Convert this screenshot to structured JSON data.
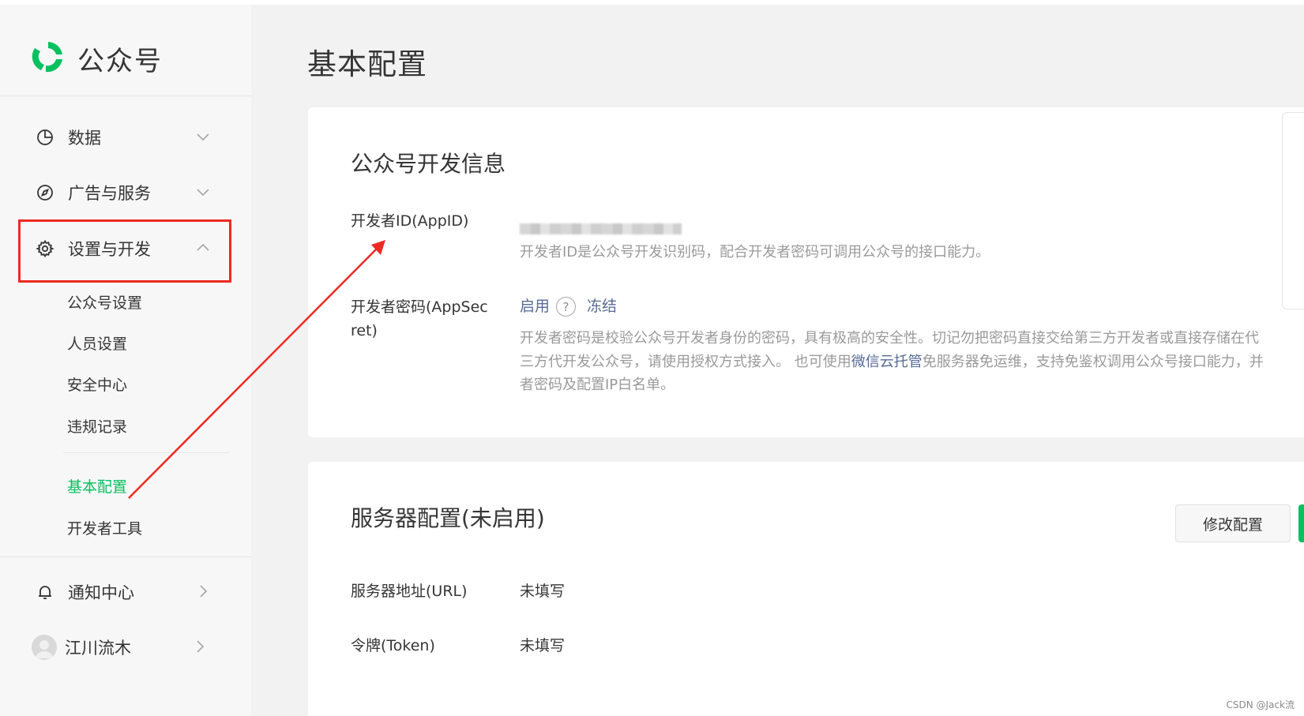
{
  "app": {
    "name": "公众号"
  },
  "sidebar": {
    "menus": [
      {
        "label": "数据",
        "icon": "chart-pie-icon",
        "chevron": "chevron-down-icon"
      },
      {
        "label": "广告与服务",
        "icon": "compass-icon",
        "chevron": "chevron-down-icon"
      },
      {
        "label": "设置与开发",
        "icon": "gear-icon",
        "chevron": "chevron-up-icon"
      }
    ],
    "submenu": [
      {
        "label": "公众号设置"
      },
      {
        "label": "人员设置"
      },
      {
        "label": "安全中心"
      },
      {
        "label": "违规记录"
      },
      {
        "label": "基本配置",
        "active": true
      },
      {
        "label": "开发者工具"
      }
    ],
    "notification": {
      "label": "通知中心",
      "icon": "bell-icon"
    },
    "account": {
      "label": "江川流木"
    }
  },
  "page": {
    "title": "基本配置"
  },
  "dev_info": {
    "title": "公众号开发信息",
    "appid": {
      "label": "开发者ID(AppID)",
      "hint": "开发者ID是公众号开发识别码，配合开发者密码可调用公众号的接口能力。"
    },
    "appsecret": {
      "label_line1": "开发者密码(AppSec",
      "label_line2": "ret)",
      "enable": "启用",
      "help": "?",
      "freeze": "冻结",
      "hint_line1": "开发者密码是校验公众号开发者身份的密码，具有极高的安全性。切记勿把密码直接交给第三方开发者或直接存储在代",
      "hint_line2_pre": "三方代开发公众号，请使用授权方式接入。 也可使用",
      "hint_line2_link": "微信云托管",
      "hint_line2_post": "免服务器免运维，支持免鉴权调用公众号接口能力，并",
      "hint_line3": "者密码及配置IP白名单。"
    }
  },
  "server_config": {
    "title": "服务器配置(未启用)",
    "modify_button": "修改配置",
    "url": {
      "label": "服务器地址(URL)",
      "value": "未填写"
    },
    "token": {
      "label": "令牌(Token)",
      "value": "未填写"
    }
  },
  "watermark": "CSDN @Jack流",
  "colors": {
    "brand_green": "#07c160",
    "highlight_red": "#ee2a22",
    "link_blue": "#576b95"
  }
}
